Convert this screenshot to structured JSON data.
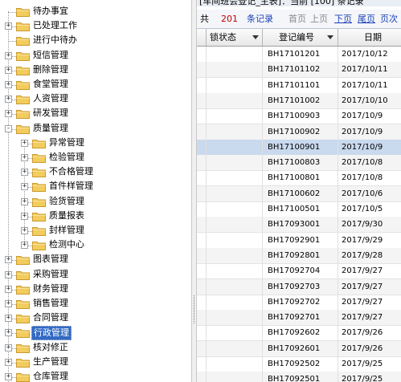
{
  "title_bar": "[车间班会登记_主表]：当前 [100] 条记录",
  "pager": {
    "total_prefix": "共",
    "total_count": "201",
    "total_suffix": "条记录",
    "first": "首页",
    "prev": "上页",
    "next": "下页",
    "last": "尾页",
    "page": "页次"
  },
  "grid": {
    "columns": [
      "锁状态",
      "登记编号",
      "日期"
    ],
    "rows": [
      {
        "code": "BH17101201",
        "date": "2017/10/12"
      },
      {
        "code": "BH17101102",
        "date": "2017/10/11"
      },
      {
        "code": "BH17101101",
        "date": "2017/10/11"
      },
      {
        "code": "BH17101002",
        "date": "2017/10/10"
      },
      {
        "code": "BH17100903",
        "date": "2017/10/9"
      },
      {
        "code": "BH17100902",
        "date": "2017/10/9"
      },
      {
        "code": "BH17100901",
        "date": "2017/10/9"
      },
      {
        "code": "BH17100803",
        "date": "2017/10/8"
      },
      {
        "code": "BH17100801",
        "date": "2017/10/8"
      },
      {
        "code": "BH17100602",
        "date": "2017/10/6"
      },
      {
        "code": "BH17100501",
        "date": "2017/10/5"
      },
      {
        "code": "BH17093001",
        "date": "2017/9/30"
      },
      {
        "code": "BH17092901",
        "date": "2017/9/29"
      },
      {
        "code": "BH17092801",
        "date": "2017/9/28"
      },
      {
        "code": "BH17092704",
        "date": "2017/9/27"
      },
      {
        "code": "BH17092703",
        "date": "2017/9/27"
      },
      {
        "code": "BH17092702",
        "date": "2017/9/27"
      },
      {
        "code": "BH17092701",
        "date": "2017/9/27"
      },
      {
        "code": "BH17092602",
        "date": "2017/9/26"
      },
      {
        "code": "BH17092601",
        "date": "2017/9/26"
      },
      {
        "code": "BH17092502",
        "date": "2017/9/25"
      },
      {
        "code": "BH17092501",
        "date": "2017/9/25"
      }
    ],
    "selected_index": 6
  },
  "tree": [
    {
      "label": "待办事宜",
      "level": 0,
      "expander": ""
    },
    {
      "label": "已处理工作",
      "level": 0,
      "expander": "+"
    },
    {
      "label": "进行中待办",
      "level": 0,
      "expander": ""
    },
    {
      "label": "短信管理",
      "level": 0,
      "expander": "+"
    },
    {
      "label": "删除管理",
      "level": 0,
      "expander": "+"
    },
    {
      "label": "食堂管理",
      "level": 0,
      "expander": "+"
    },
    {
      "label": "人资管理",
      "level": 0,
      "expander": "+"
    },
    {
      "label": "研发管理",
      "level": 0,
      "expander": "+"
    },
    {
      "label": "质量管理",
      "level": 0,
      "expander": "-"
    },
    {
      "label": "异常管理",
      "level": 1,
      "expander": "+"
    },
    {
      "label": "检验管理",
      "level": 1,
      "expander": "+"
    },
    {
      "label": "不合格管理",
      "level": 1,
      "expander": "+"
    },
    {
      "label": "首件样管理",
      "level": 1,
      "expander": "+"
    },
    {
      "label": "验货管理",
      "level": 1,
      "expander": "+"
    },
    {
      "label": "质量报表",
      "level": 1,
      "expander": "+"
    },
    {
      "label": "封样管理",
      "level": 1,
      "expander": "+"
    },
    {
      "label": "检测中心",
      "level": 1,
      "expander": "+"
    },
    {
      "label": "图表管理",
      "level": 0,
      "expander": "+"
    },
    {
      "label": "采购管理",
      "level": 0,
      "expander": "+"
    },
    {
      "label": "财务管理",
      "level": 0,
      "expander": "+"
    },
    {
      "label": "销售管理",
      "level": 0,
      "expander": "+"
    },
    {
      "label": "合同管理",
      "level": 0,
      "expander": "+"
    },
    {
      "label": "行政管理",
      "level": 0,
      "expander": "+",
      "selected": true
    },
    {
      "label": "核对修正",
      "level": 0,
      "expander": "+"
    },
    {
      "label": "生产管理",
      "level": 0,
      "expander": "+"
    },
    {
      "label": "仓库管理",
      "level": 0,
      "expander": "+"
    }
  ],
  "colors": {
    "link_blue": "#1a3fb4",
    "count_red": "#c00000",
    "folder_yellow": "#f3cc5e",
    "selected_row": "#c9d9ee",
    "tree_selected": "#316ac5"
  },
  "icons": [
    "folder-icon",
    "expand-plus-icon",
    "collapse-minus-icon",
    "sort-arrow-icon"
  ]
}
